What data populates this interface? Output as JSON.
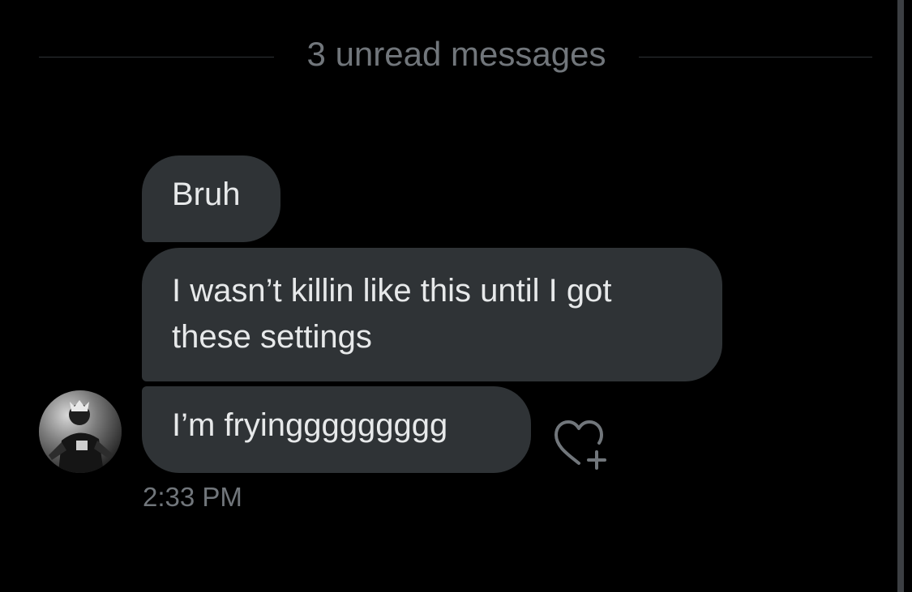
{
  "divider": {
    "label": "3 unread messages"
  },
  "messages": [
    {
      "lines": [
        "Bruh"
      ]
    },
    {
      "lines": [
        "I wasn’t killin like this until I got",
        "these settings"
      ]
    },
    {
      "lines": [
        "I’m fryinggggggggg"
      ]
    }
  ],
  "timestamp": "2:33 PM",
  "reaction_button": {
    "icon": "heart-plus-icon"
  },
  "avatar": {
    "icon": "user-avatar"
  },
  "colors": {
    "background": "#000000",
    "bubble": "#2f3336",
    "bubble_text": "#e7e9ea",
    "muted_text": "#71767b",
    "divider_line": "#2f3336"
  }
}
